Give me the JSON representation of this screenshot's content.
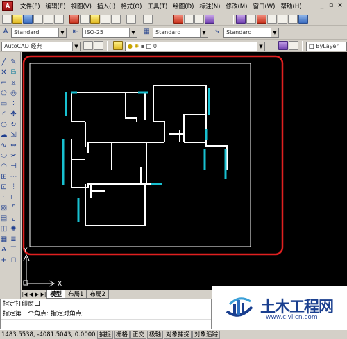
{
  "menu": {
    "items": [
      "文件(F)",
      "编辑(E)",
      "视图(V)",
      "插入(I)",
      "格式(O)",
      "工具(T)",
      "绘图(D)",
      "标注(N)",
      "修改(M)",
      "窗口(W)",
      "帮助(H)"
    ],
    "app_icon": "cad-app-icon",
    "controls": [
      "_",
      "▫",
      "×"
    ]
  },
  "styles_toolbar": {
    "text_style": "Standard",
    "dim_style": "ISO-25",
    "table_style": "Standard",
    "multileader_style": "Standard"
  },
  "workspace_toolbar": {
    "workspace": "AutoCAD 经典",
    "layer": "0",
    "linetype": "ByLayer"
  },
  "tabs": {
    "model": "模型",
    "layout1": "布局1",
    "layout2": "布局2"
  },
  "command_line": {
    "history_1": "指定打印窗口",
    "history_2": "指定第一个角点: 指定对角点:"
  },
  "status_bar": {
    "coords": "1483.5538, -4081.5043, 0.0000",
    "buttons": [
      "捕捉",
      "栅格",
      "正交",
      "极轴",
      "对象捕捉",
      "对象追踪"
    ]
  },
  "canvas": {
    "ucs_x_label": "X",
    "ucs_y_label": "Y",
    "selection_color": "#e02020",
    "wall_color": "#ffffff",
    "window_color": "#18c0d0"
  },
  "watermark": {
    "title": "土木工程网",
    "url": "www.civilcn.com"
  }
}
